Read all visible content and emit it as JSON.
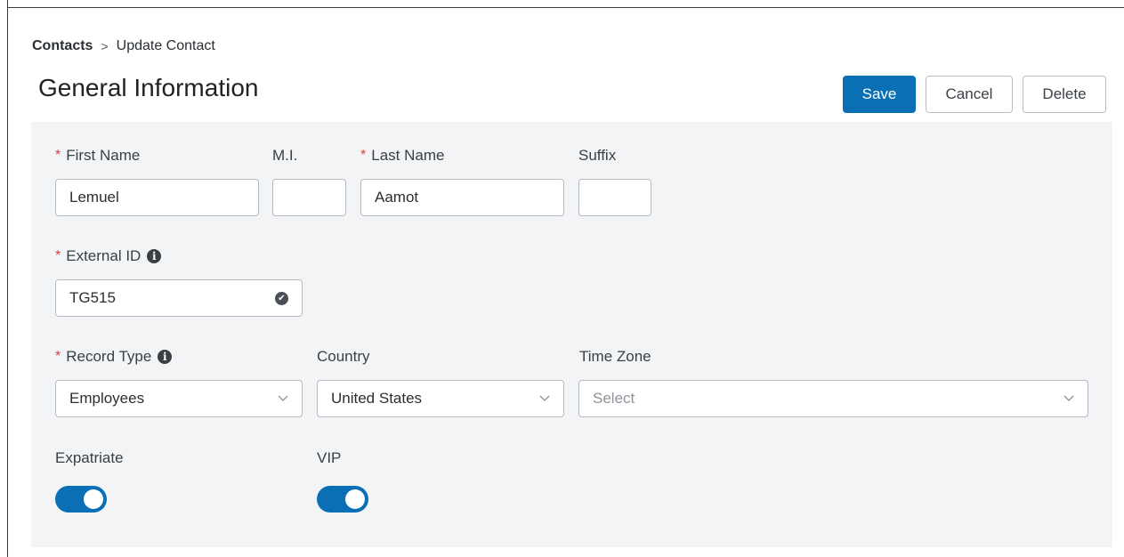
{
  "breadcrumb": {
    "parent": "Contacts",
    "separator": ">",
    "current": "Update Contact"
  },
  "page_title": "General Information",
  "actions": {
    "save": "Save",
    "cancel": "Cancel",
    "delete": "Delete"
  },
  "colors": {
    "primary": "#0a6fb5",
    "required": "#d94040",
    "panel_bg": "#f3f4f6"
  },
  "required_marker": "*",
  "form": {
    "first_name": {
      "label": "First Name",
      "value": "Lemuel",
      "required": true
    },
    "middle_initial": {
      "label": "M.I.",
      "value": ""
    },
    "last_name": {
      "label": "Last Name",
      "value": "Aamot",
      "required": true
    },
    "suffix": {
      "label": "Suffix",
      "value": ""
    },
    "external_id": {
      "label": "External ID",
      "value": "TG515",
      "required": true,
      "info_icon": "info-icon",
      "status_icon": "check-circle-icon"
    },
    "record_type": {
      "label": "Record Type",
      "value": "Employees",
      "required": true,
      "info_icon": "info-icon"
    },
    "country": {
      "label": "Country",
      "value": "United States"
    },
    "time_zone": {
      "label": "Time Zone",
      "value": "",
      "placeholder": "Select"
    },
    "expatriate": {
      "label": "Expatriate",
      "on": true
    },
    "vip": {
      "label": "VIP",
      "on": true
    }
  }
}
